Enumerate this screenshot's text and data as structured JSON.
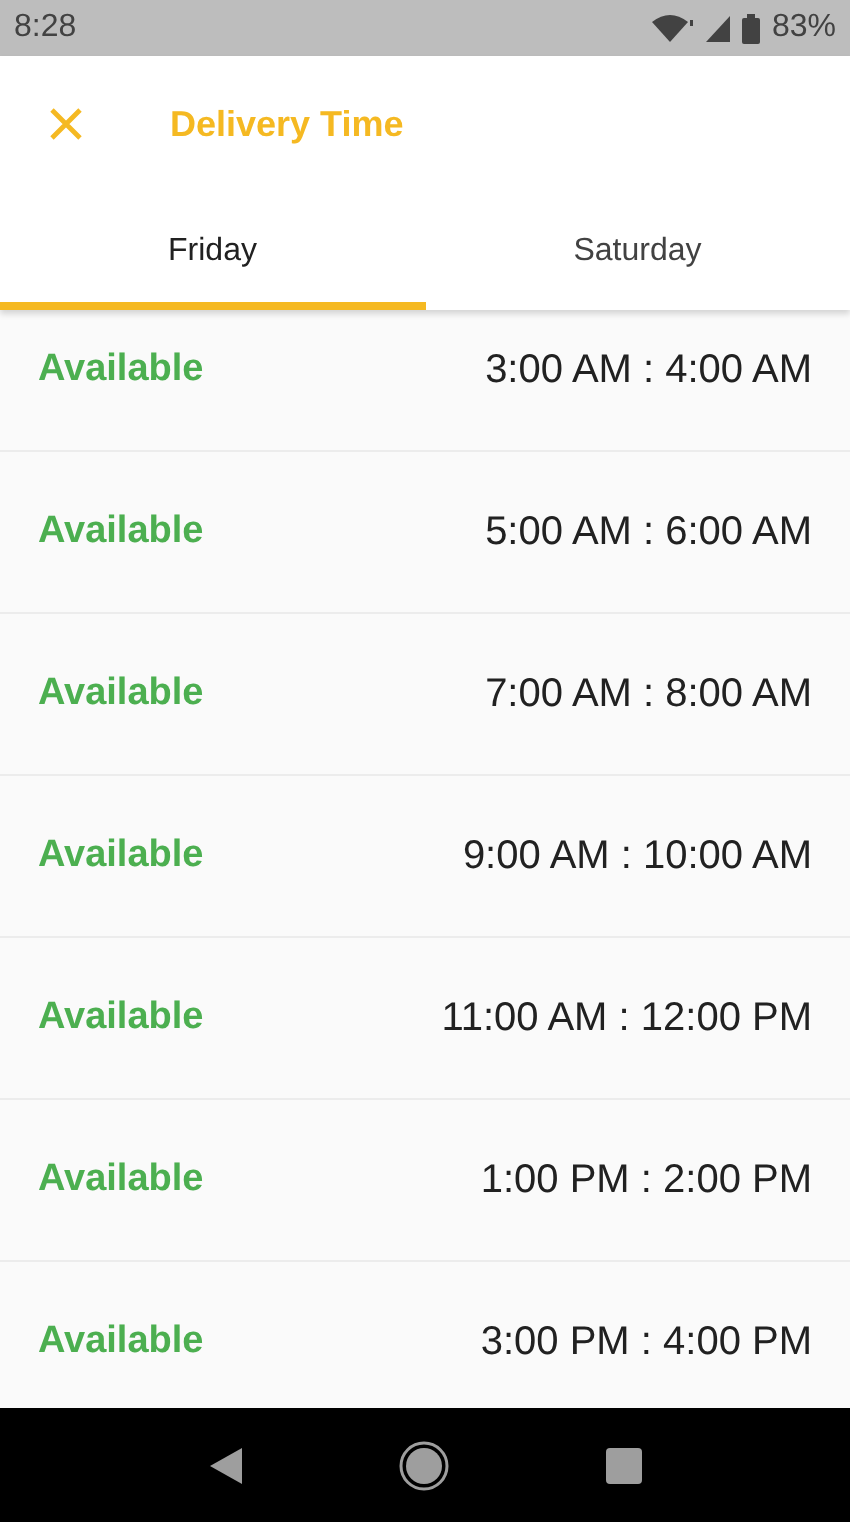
{
  "status_bar": {
    "time": "8:28",
    "battery": "83%"
  },
  "header": {
    "title": "Delivery Time"
  },
  "tabs": [
    {
      "label": "Friday",
      "selected": true
    },
    {
      "label": "Saturday",
      "selected": false
    }
  ],
  "slots": [
    {
      "status": "Available",
      "time": "3:00 AM : 4:00 AM"
    },
    {
      "status": "Available",
      "time": "5:00 AM : 6:00 AM"
    },
    {
      "status": "Available",
      "time": "7:00 AM : 8:00 AM"
    },
    {
      "status": "Available",
      "time": "9:00 AM : 10:00 AM"
    },
    {
      "status": "Available",
      "time": "11:00 AM : 12:00 PM"
    },
    {
      "status": "Available",
      "time": "1:00 PM : 2:00 PM"
    },
    {
      "status": "Available",
      "time": "3:00 PM : 4:00 PM"
    }
  ]
}
